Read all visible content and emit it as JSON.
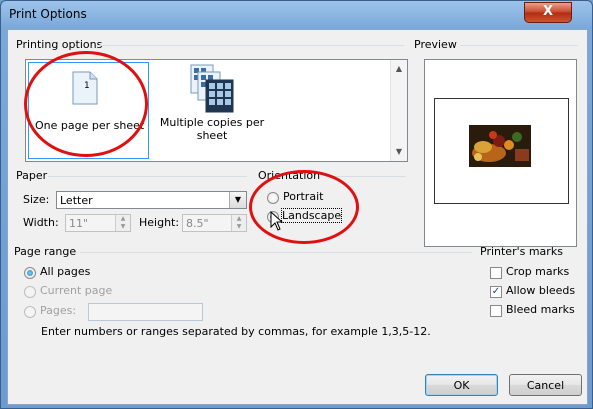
{
  "window": {
    "title": "Print Options",
    "close_label": "X"
  },
  "printing_options": {
    "label": "Printing options",
    "items": [
      {
        "label": "One page per sheet",
        "page_number": "1",
        "selected": true
      },
      {
        "label": "Multiple copies per sheet",
        "selected": false
      }
    ]
  },
  "preview": {
    "label": "Preview"
  },
  "paper": {
    "label": "Paper",
    "size_label": "Size:",
    "size_value": "Letter",
    "width_label": "Width:",
    "width_value": "11\"",
    "height_label": "Height:",
    "height_value": "8.5\""
  },
  "orientation": {
    "label": "Orientation",
    "options": [
      {
        "label": "Portrait",
        "selected": false
      },
      {
        "label": "Landscape",
        "selected": true
      }
    ]
  },
  "page_range": {
    "label": "Page range",
    "all_pages": "All pages",
    "current_page": "Current page",
    "pages": "Pages:",
    "pages_value": "",
    "hint": "Enter numbers or ranges separated by commas, for example 1,3,5-12."
  },
  "printers_marks": {
    "label": "Printer's marks",
    "items": [
      {
        "label": "Crop marks",
        "checked": false
      },
      {
        "label": "Allow bleeds",
        "checked": true
      },
      {
        "label": "Bleed marks",
        "checked": false
      }
    ]
  },
  "buttons": {
    "ok": "OK",
    "cancel": "Cancel"
  },
  "colors": {
    "annotation_circle": "#e01010",
    "selection": "#3399ff"
  }
}
